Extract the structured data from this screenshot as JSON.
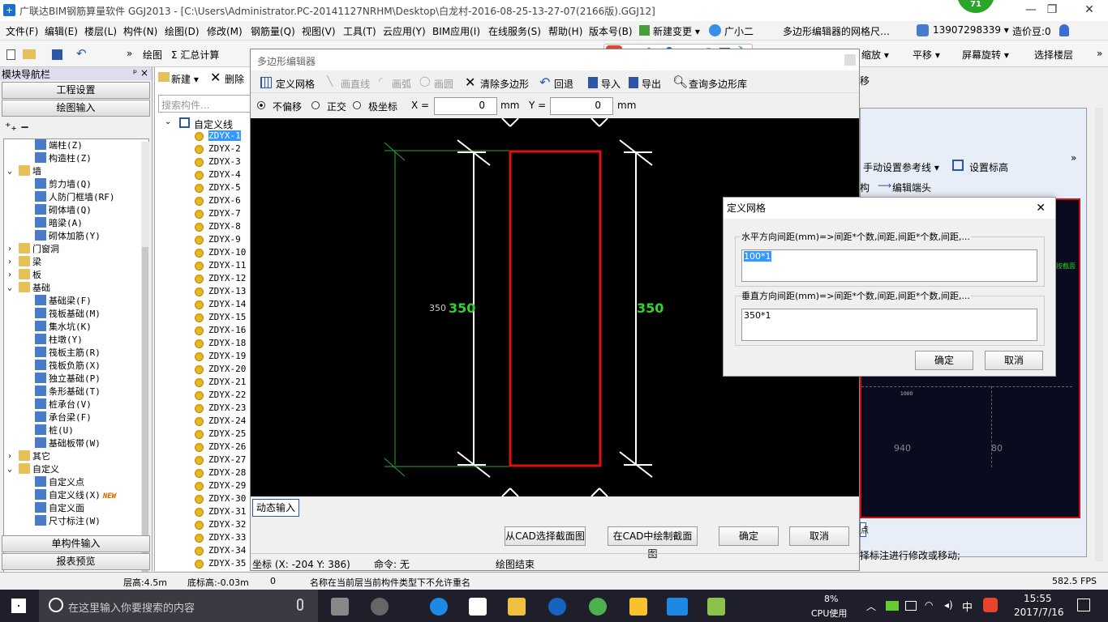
{
  "title_bar": {
    "title": "广联达BIM钢筋算量软件 GGJ2013 - [C:\\Users\\Administrator.PC-20141127NRHM\\Desktop\\白龙村-2016-08-25-13-27-07(2166版).GGJ12]",
    "badge": "71",
    "minimize": "—",
    "restore": "❐",
    "close": "✕"
  },
  "menu": [
    "文件(F)",
    "编辑(E)",
    "楼层(L)",
    "构件(N)",
    "绘图(D)",
    "修改(M)",
    "钢筋量(Q)",
    "视图(V)",
    "工具(T)",
    "云应用(Y)",
    "BIM应用(I)",
    "在线服务(S)",
    "帮助(H)",
    "版本号(B)",
    "新建变更 ▾",
    "广小二"
  ],
  "menu_right": {
    "notice": "多边形编辑器的网格尺…",
    "phone": "13907298339 ▾",
    "price": "造价豆:0"
  },
  "toolbar": {
    "draw": "绘图",
    "sum": "Σ 汇总计算",
    "zoom": "缩放 ▾",
    "pan": "平移 ▾",
    "rotate": "屏幕旋转 ▾",
    "select_floor": "选择楼层"
  },
  "left_panel": {
    "title": "模块导航栏",
    "pin": "ᵖ ×",
    "btn_project": "工程设置",
    "btn_draw": "绘图输入",
    "btn_single": "单构件输入",
    "btn_report": "报表预览",
    "tree": [
      {
        "label": "端柱(Z)",
        "indent": 2,
        "icon": "blue"
      },
      {
        "label": "构造柱(Z)",
        "indent": 2,
        "icon": "blue"
      },
      {
        "label": "墙",
        "indent": 1,
        "icon": "folder",
        "exp": "⌄"
      },
      {
        "label": "剪力墙(Q)",
        "indent": 2,
        "icon": "blue"
      },
      {
        "label": "人防门框墙(RF)",
        "indent": 2,
        "icon": "blue"
      },
      {
        "label": "砌体墙(Q)",
        "indent": 2,
        "icon": "blue"
      },
      {
        "label": "暗梁(A)",
        "indent": 2,
        "icon": "blue"
      },
      {
        "label": "砌体加筋(Y)",
        "indent": 2,
        "icon": "blue"
      },
      {
        "label": "门窗洞",
        "indent": 1,
        "icon": "folder",
        "exp": "›"
      },
      {
        "label": "梁",
        "indent": 1,
        "icon": "folder",
        "exp": "›"
      },
      {
        "label": "板",
        "indent": 1,
        "icon": "folder",
        "exp": "›"
      },
      {
        "label": "基础",
        "indent": 1,
        "icon": "folder",
        "exp": "⌄"
      },
      {
        "label": "基础梁(F)",
        "indent": 2,
        "icon": "blue"
      },
      {
        "label": "筏板基础(M)",
        "indent": 2,
        "icon": "blue"
      },
      {
        "label": "集水坑(K)",
        "indent": 2,
        "icon": "blue"
      },
      {
        "label": "柱墩(Y)",
        "indent": 2,
        "icon": "blue"
      },
      {
        "label": "筏板主筋(R)",
        "indent": 2,
        "icon": "blue"
      },
      {
        "label": "筏板负筋(X)",
        "indent": 2,
        "icon": "blue"
      },
      {
        "label": "独立基础(P)",
        "indent": 2,
        "icon": "blue"
      },
      {
        "label": "条形基础(T)",
        "indent": 2,
        "icon": "blue"
      },
      {
        "label": "桩承台(V)",
        "indent": 2,
        "icon": "blue"
      },
      {
        "label": "承台梁(F)",
        "indent": 2,
        "icon": "blue"
      },
      {
        "label": "桩(U)",
        "indent": 2,
        "icon": "blue"
      },
      {
        "label": "基础板带(W)",
        "indent": 2,
        "icon": "blue"
      },
      {
        "label": "其它",
        "indent": 1,
        "icon": "folder",
        "exp": "›"
      },
      {
        "label": "自定义",
        "indent": 1,
        "icon": "folder",
        "exp": "⌄"
      },
      {
        "label": "自定义点",
        "indent": 2,
        "icon": "blue"
      },
      {
        "label": "自定义线(X)",
        "indent": 2,
        "icon": "blue",
        "new": "NEW"
      },
      {
        "label": "自定义面",
        "indent": 2,
        "icon": "blue"
      },
      {
        "label": "尺寸标注(W)",
        "indent": 2,
        "icon": "blue"
      }
    ]
  },
  "mid_panel": {
    "new": "新建 ▾",
    "delete": "删除",
    "search": "搜索构件...",
    "root": "自定义线",
    "items": [
      "ZDYX-1",
      "ZDYX-2",
      "ZDYX-3",
      "ZDYX-4",
      "ZDYX-5",
      "ZDYX-6",
      "ZDYX-7",
      "ZDYX-8",
      "ZDYX-9",
      "ZDYX-10",
      "ZDYX-11",
      "ZDYX-12",
      "ZDYX-13",
      "ZDYX-14",
      "ZDYX-15",
      "ZDYX-16",
      "ZDYX-18",
      "ZDYX-19",
      "ZDYX-20",
      "ZDYX-21",
      "ZDYX-22",
      "ZDYX-23",
      "ZDYX-24",
      "ZDYX-25",
      "ZDYX-26",
      "ZDYX-27",
      "ZDYX-28",
      "ZDYX-29",
      "ZDYX-30",
      "ZDYX-31",
      "ZDYX-32",
      "ZDYX-33",
      "ZDYX-34",
      "ZDYX-35"
    ]
  },
  "editor": {
    "title": "多边形编辑器",
    "tools": {
      "grid": "定义网格",
      "line": "画直线",
      "arc": "画弧",
      "circle": "画圆",
      "clear": "清除多边形",
      "undo": "回退",
      "import": "导入",
      "export": "导出",
      "query": "查询多边形库"
    },
    "modes": {
      "none": "不偏移",
      "ortho": "正交",
      "polar": "极坐标"
    },
    "x_label": "X =",
    "x_value": "0",
    "y_label": "Y =",
    "y_value": "0",
    "unit": "mm",
    "dim_left_small": "350",
    "dim_left": "350",
    "dim_right": "350",
    "dynamic": "动态输入",
    "btn_cad_select": "从CAD选择截面图",
    "btn_cad_draw": "在CAD中绘制截面图",
    "btn_ok": "确定",
    "btn_cancel": "取消",
    "coord": "坐标 (X: -204 Y: 386)",
    "cmd": "命令: 无",
    "draw_end": "绘图结束"
  },
  "right_panel": {
    "ref": "手动设置参考线 ▾",
    "elev": "设置标高",
    "shift": "移",
    "structure": "构",
    "edit_end": "编辑端头",
    "red_label": "按截面",
    "dim_1000": "1000",
    "dim_940": "940",
    "dim_80": "80",
    "hint": "择标注进行修改或移动;",
    "point": "点"
  },
  "dialog": {
    "title": "定义网格",
    "close": "✕",
    "h_label": "水平方向间距(mm)=>间距*个数,间距,间距*个数,间距,...",
    "h_value": "100*1",
    "v_label": "垂直方向间距(mm)=>间距*个数,间距,间距*个数,间距,...",
    "v_value": "350*1",
    "ok": "确定",
    "cancel": "取消"
  },
  "status": {
    "floor_h": "层高:4.5m",
    "bottom": "底标高:-0.03m",
    "zero": "0",
    "msg": "名称在当前层当前构件类型下不允许重名",
    "fps": "582.5 FPS"
  },
  "taskbar": {
    "search": "在这里输入你要搜索的内容",
    "cpu": "8%",
    "cpu_label": "CPU使用",
    "lang": "中",
    "time": "15:55",
    "date": "2017/7/16"
  },
  "colors": {
    "red": "#e01010",
    "green_dim": "#32d232",
    "selection": "#3399ff"
  }
}
